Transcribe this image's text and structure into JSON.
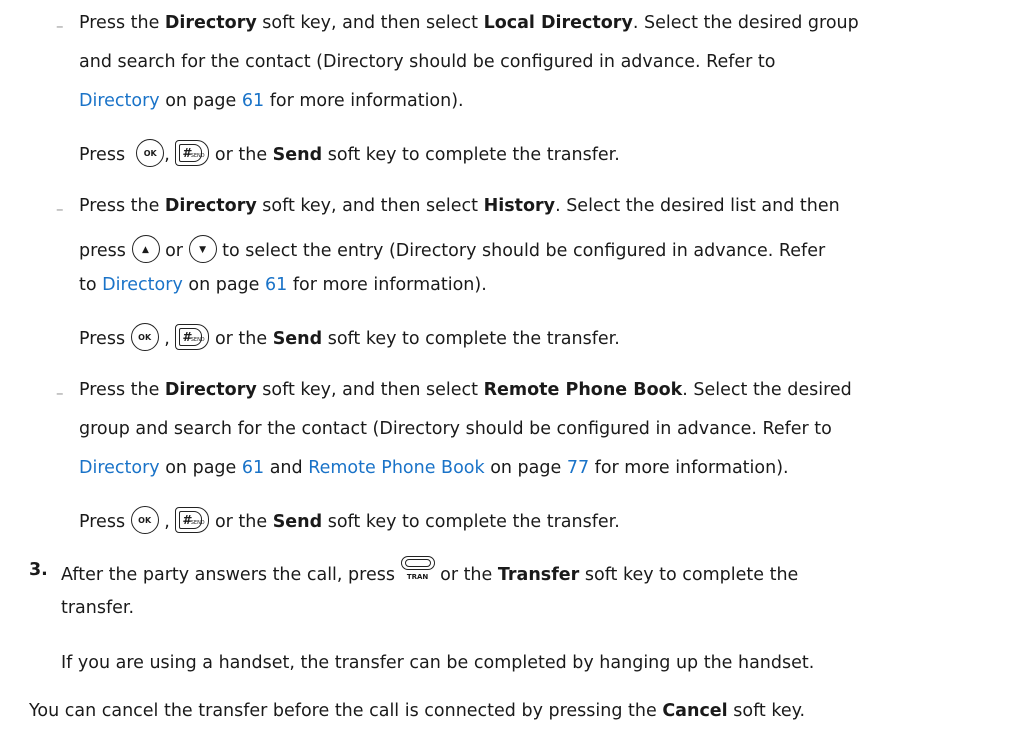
{
  "doc": {
    "dash": "–",
    "b1": {
      "l1a": "Press the ",
      "directory": "Directory",
      "l1b": " soft key, and then select ",
      "local_dir": "Local Directory",
      "l1c": ". Select the desired group",
      "l2": "and search for the contact (Directory should be configured in advance. Refer to",
      "link_directory": "Directory",
      "on_page": " on page ",
      "page_61": "61",
      "l3b": " for more information)."
    },
    "press": {
      "press": "Press",
      "comma": ",",
      "or_the": " or the ",
      "send": "Send",
      "complete": " soft key to complete the transfer."
    },
    "b2": {
      "l1a": "Press the ",
      "directory": "Directory",
      "l1b": " soft key, and then select ",
      "history": "History",
      "l1c": ". Select the desired list and then",
      "l2a": "press",
      "or": "or",
      "l2b": "to select the entry (Directory should be configured in advance. Refer",
      "l3a": "to ",
      "link_directory": "Directory",
      "on_page": " on page ",
      "page_61": "61",
      "l3b": " for more information)."
    },
    "b3": {
      "l1a": "Press the ",
      "directory": "Directory",
      "l1b": " soft key, and then select ",
      "remote": "Remote Phone Book",
      "l1c": ". Select the desired",
      "l2": "group and search for the contact (Directory should be configured in advance. Refer to",
      "link_directory": "Directory",
      "on_page": " on page ",
      "page_61": "61",
      "and": " and ",
      "link_remote": "Remote Phone Book",
      "on_page2": " on page ",
      "page_77": "77",
      "l3b": " for more information)."
    },
    "step3": {
      "num": "3.",
      "l1a": "After the party answers the call, press",
      "l1b": " or the ",
      "transfer": "Transfer",
      "l1c": " soft key to complete the",
      "l2": "transfer."
    },
    "handset_note": "If you are using a handset, the transfer can be completed by hanging up the handset.",
    "cancel": {
      "a": "You can cancel the transfer before the call is connected by pressing the ",
      "cancel": "Cancel",
      "b": " soft key."
    },
    "keys": {
      "ok": "OK",
      "hash": "#",
      "send_small": "SEND",
      "up": "▲",
      "down": "▼",
      "tran": "TRAN"
    }
  }
}
